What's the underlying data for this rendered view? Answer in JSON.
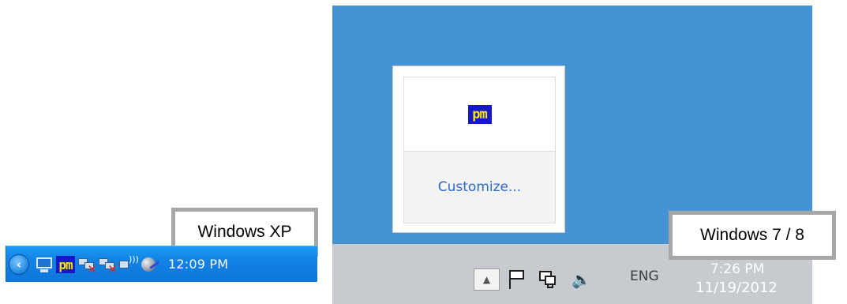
{
  "xp": {
    "label": "Windows XP",
    "tray_icons": [
      "chevron-left-icon",
      "display-icon",
      "pm-app-icon",
      "network-disconnected-icon",
      "network-disconnected-icon",
      "wireless-icon",
      "volume-icon"
    ],
    "pm_text": "pm",
    "clock": "12:09 PM",
    "colors": {
      "taskbar": "#1182e4",
      "pm_bg": "#1518c8",
      "pm_fg": "#f7e300"
    }
  },
  "win8": {
    "label": "Windows 7 / 8",
    "popup": {
      "pm_text": "pm",
      "customize_link": "Customize..."
    },
    "tray_icons": [
      "show-hidden-icons-up-arrow",
      "action-center-flag-icon",
      "network-icon",
      "speaker-icon"
    ],
    "language": "ENG",
    "time": "7:26 PM",
    "date": "11/19/2012",
    "colors": {
      "desktop": "#4593d2",
      "taskbar": "#c7cbd0",
      "link": "#2a6bc8"
    }
  }
}
